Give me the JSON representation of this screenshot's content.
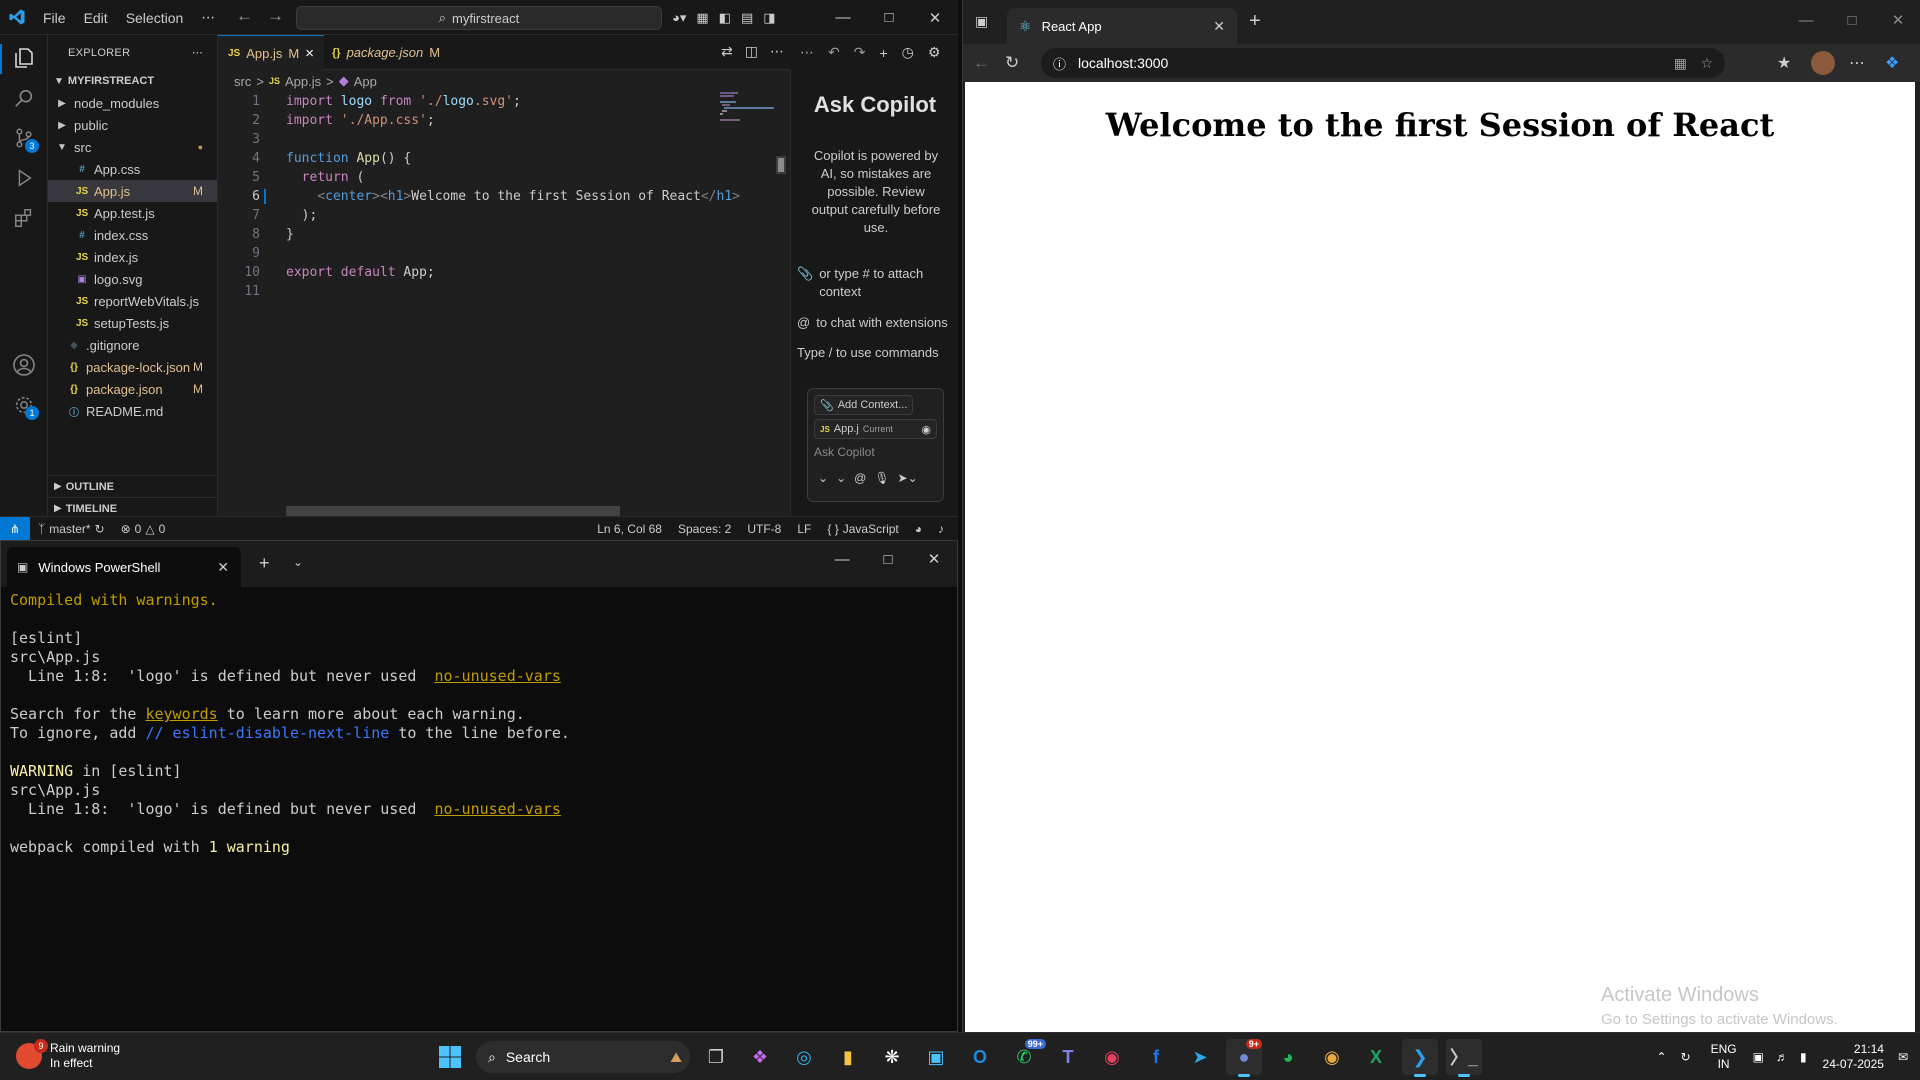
{
  "vscode": {
    "menu": [
      "File",
      "Edit",
      "Selection",
      "⋯"
    ],
    "search_text": "myfirstreact",
    "activity_badges": {
      "scm": "3",
      "settings": "1"
    },
    "explorer_title": "EXPLORER",
    "project_name": "MYFIRSTREACT",
    "tree": [
      {
        "name": "node_modules",
        "kind": "folder",
        "indent": 1,
        "badge": ""
      },
      {
        "name": "public",
        "kind": "folder",
        "indent": 1,
        "badge": ""
      },
      {
        "name": "src",
        "kind": "folder-open",
        "indent": 1,
        "badge": "●"
      },
      {
        "name": "App.css",
        "kind": "css",
        "indent": 2,
        "badge": ""
      },
      {
        "name": "App.js",
        "kind": "js",
        "indent": 2,
        "badge": "M"
      },
      {
        "name": "App.test.js",
        "kind": "js",
        "indent": 2,
        "badge": ""
      },
      {
        "name": "index.css",
        "kind": "css",
        "indent": 2,
        "badge": ""
      },
      {
        "name": "index.js",
        "kind": "js",
        "indent": 2,
        "badge": ""
      },
      {
        "name": "logo.svg",
        "kind": "svg",
        "indent": 2,
        "badge": ""
      },
      {
        "name": "reportWebVitals.js",
        "kind": "js",
        "indent": 2,
        "badge": ""
      },
      {
        "name": "setupTests.js",
        "kind": "js",
        "indent": 2,
        "badge": ""
      },
      {
        "name": ".gitignore",
        "kind": "git",
        "indent": 1,
        "badge": ""
      },
      {
        "name": "package-lock.json",
        "kind": "json",
        "indent": 1,
        "badge": "M"
      },
      {
        "name": "package.json",
        "kind": "json",
        "indent": 1,
        "badge": "M"
      },
      {
        "name": "README.md",
        "kind": "info",
        "indent": 1,
        "badge": ""
      }
    ],
    "outline_label": "OUTLINE",
    "timeline_label": "TIMELINE",
    "tabs": [
      {
        "icon": "JS",
        "label": "App.js",
        "badge": "M",
        "close": "×"
      },
      {
        "icon": "{}",
        "label": "package.json",
        "badge": "M"
      }
    ],
    "breadcrumbs": [
      "src",
      ">",
      "JS",
      "App.js",
      ">",
      "App"
    ],
    "current_line": 6,
    "code_lines": [
      "import logo from './logo.svg';",
      "import './App.css';",
      "",
      "function App() {",
      "  return (",
      "    <center><h1>Welcome to the first Session of React</h1>",
      "  );",
      "}",
      "",
      "export default App;",
      ""
    ],
    "copilot": {
      "title": "Ask Copilot",
      "description": "Copilot is powered by AI, so mistakes are possible. Review output carefully before use.",
      "hint_attach": "or type # to attach context",
      "hint_extensions": "to chat with extensions",
      "hint_commands": "Type / to use commands",
      "add_context": "Add Context...",
      "current_file": "App.j",
      "current_label": "Current",
      "placeholder": "Ask Copilot"
    },
    "status": {
      "branch": "master*",
      "errors": "0",
      "warnings": "0",
      "position": "Ln 6, Col 68",
      "spaces": "Spaces: 2",
      "encoding": "UTF-8",
      "eol": "LF",
      "language": "JavaScript"
    }
  },
  "terminal": {
    "tab_title": "Windows PowerShell",
    "output": {
      "compiled": "Compiled with warnings.",
      "eslint_tag": "[eslint]",
      "file1": "src\\App.js",
      "line1_prefix": "  Line 1:8:  'logo' is defined but never used  ",
      "rule1": "no-unused-vars",
      "search_prefix": "Search for the ",
      "keywords": "keywords",
      "search_suffix": " to learn more about each warning.",
      "ignore_prefix": "To ignore, add ",
      "ignore_comment": "// eslint-disable-next-line",
      "ignore_suffix": " to the line before.",
      "warning_word": "WARNING",
      "warning_suffix": " in [eslint]",
      "file2": "src\\App.js",
      "line2_prefix": "  Line 1:8:  'logo' is defined but never used  ",
      "rule2": "no-unused-vars",
      "webpack_prefix": "webpack compiled with ",
      "webpack_suffix": "1 warning"
    }
  },
  "browser": {
    "tab_title": "React App",
    "url": "localhost:3000",
    "page_heading": "Welcome to the first Session of React",
    "watermark_title": "Activate Windows",
    "watermark_sub": "Go to Settings to activate Windows."
  },
  "taskbar": {
    "weather_badge": "9",
    "weather_title": "Rain warning",
    "weather_sub": "In effect",
    "search_label": "Search",
    "whatsapp_badge": "99+",
    "discord_badge": "9+",
    "lang_top": "ENG",
    "lang_bottom": "IN",
    "time": "21:14",
    "date": "24-07-2025"
  },
  "colors": {
    "vscode_accent": "#0078d4",
    "modified": "#e2c08d",
    "terminal_yellow": "#c19c00",
    "edge_bg": "#202020"
  }
}
